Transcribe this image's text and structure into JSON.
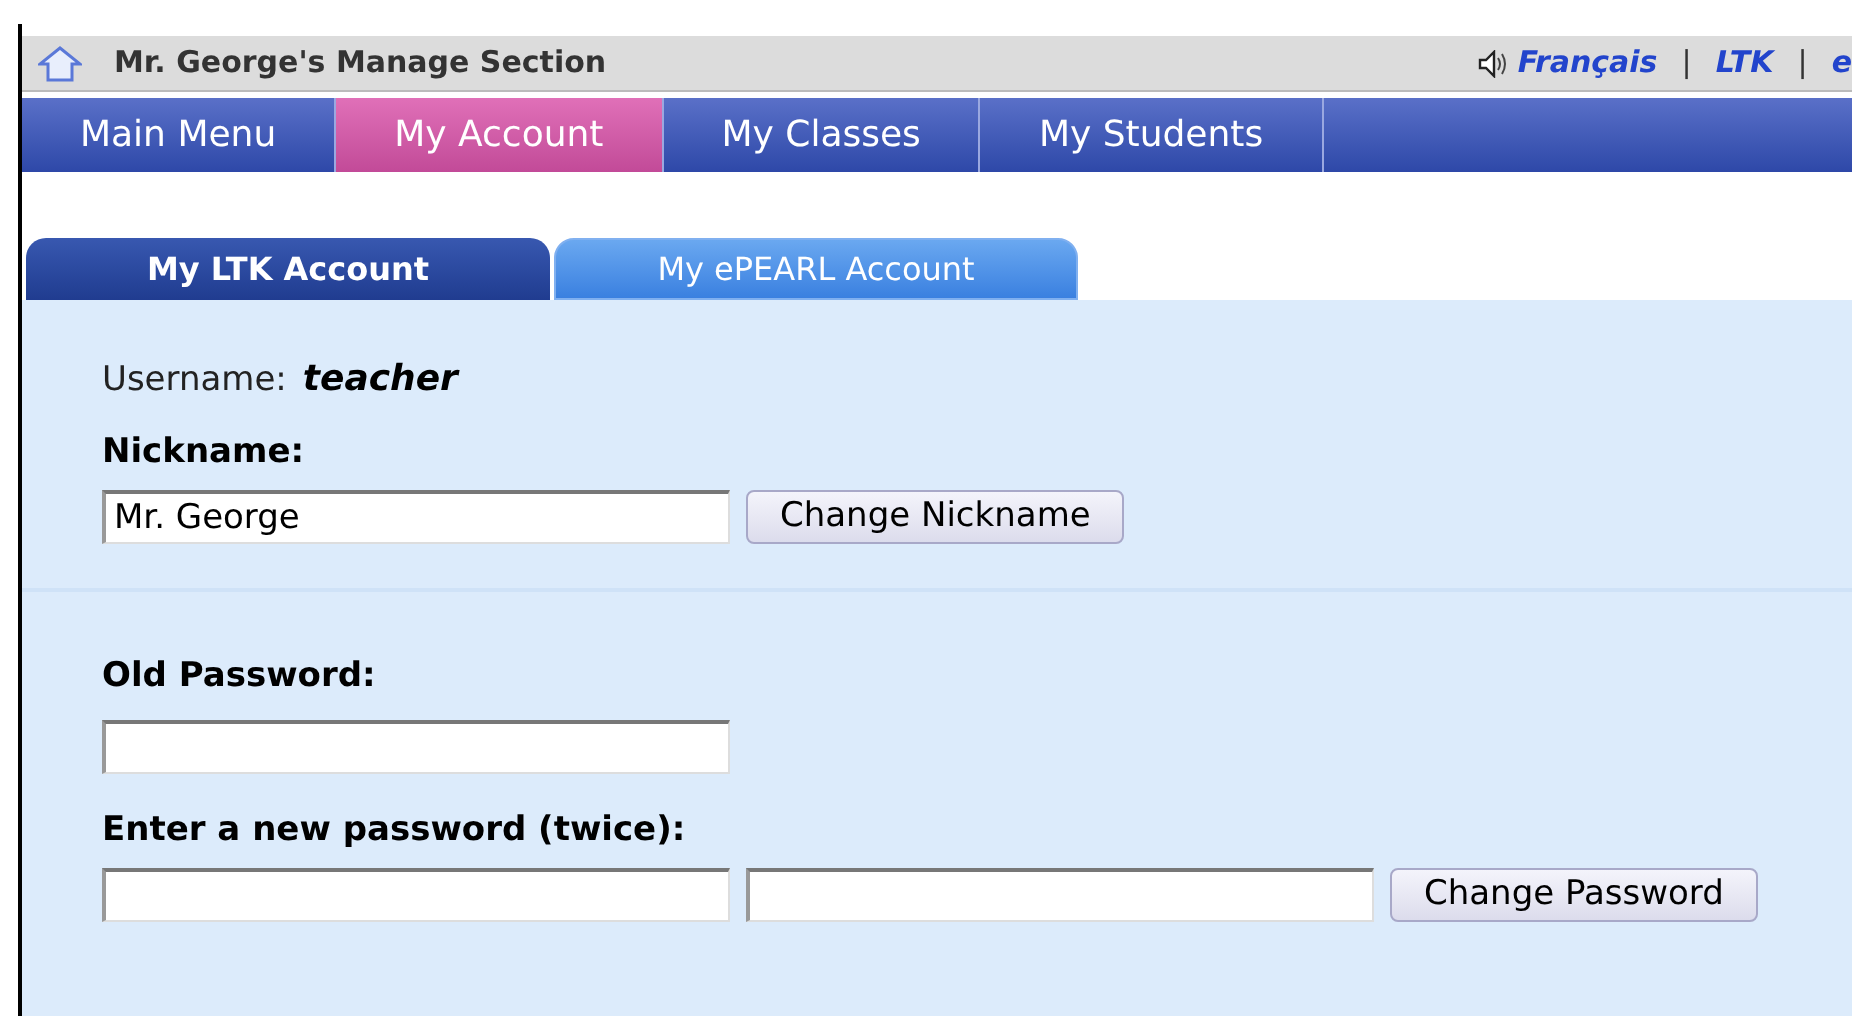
{
  "header": {
    "title": "Mr. George's Manage Section",
    "links": [
      {
        "label": "Français",
        "speaker": true
      },
      {
        "label": "|",
        "kind": "separator"
      },
      {
        "label": "LTK"
      },
      {
        "label": "|",
        "kind": "separator"
      },
      {
        "label": "e"
      }
    ]
  },
  "nav": [
    {
      "label": "Main Menu",
      "selected": false
    },
    {
      "label": "My Account",
      "selected": true
    },
    {
      "label": "My Classes",
      "selected": false
    },
    {
      "label": "My Students",
      "selected": false
    }
  ],
  "tabs": [
    {
      "label": "My LTK Account",
      "selected": true
    },
    {
      "label": "My ePEARL Account",
      "selected": false
    }
  ],
  "username": {
    "label": "Username:",
    "value": "teacher"
  },
  "nickname": {
    "label": "Nickname:",
    "value": "Mr. George",
    "button": "Change Nickname"
  },
  "old_password": {
    "label": "Old Password:"
  },
  "new_password": {
    "label": "Enter a new password (twice):",
    "button": "Change Password"
  }
}
